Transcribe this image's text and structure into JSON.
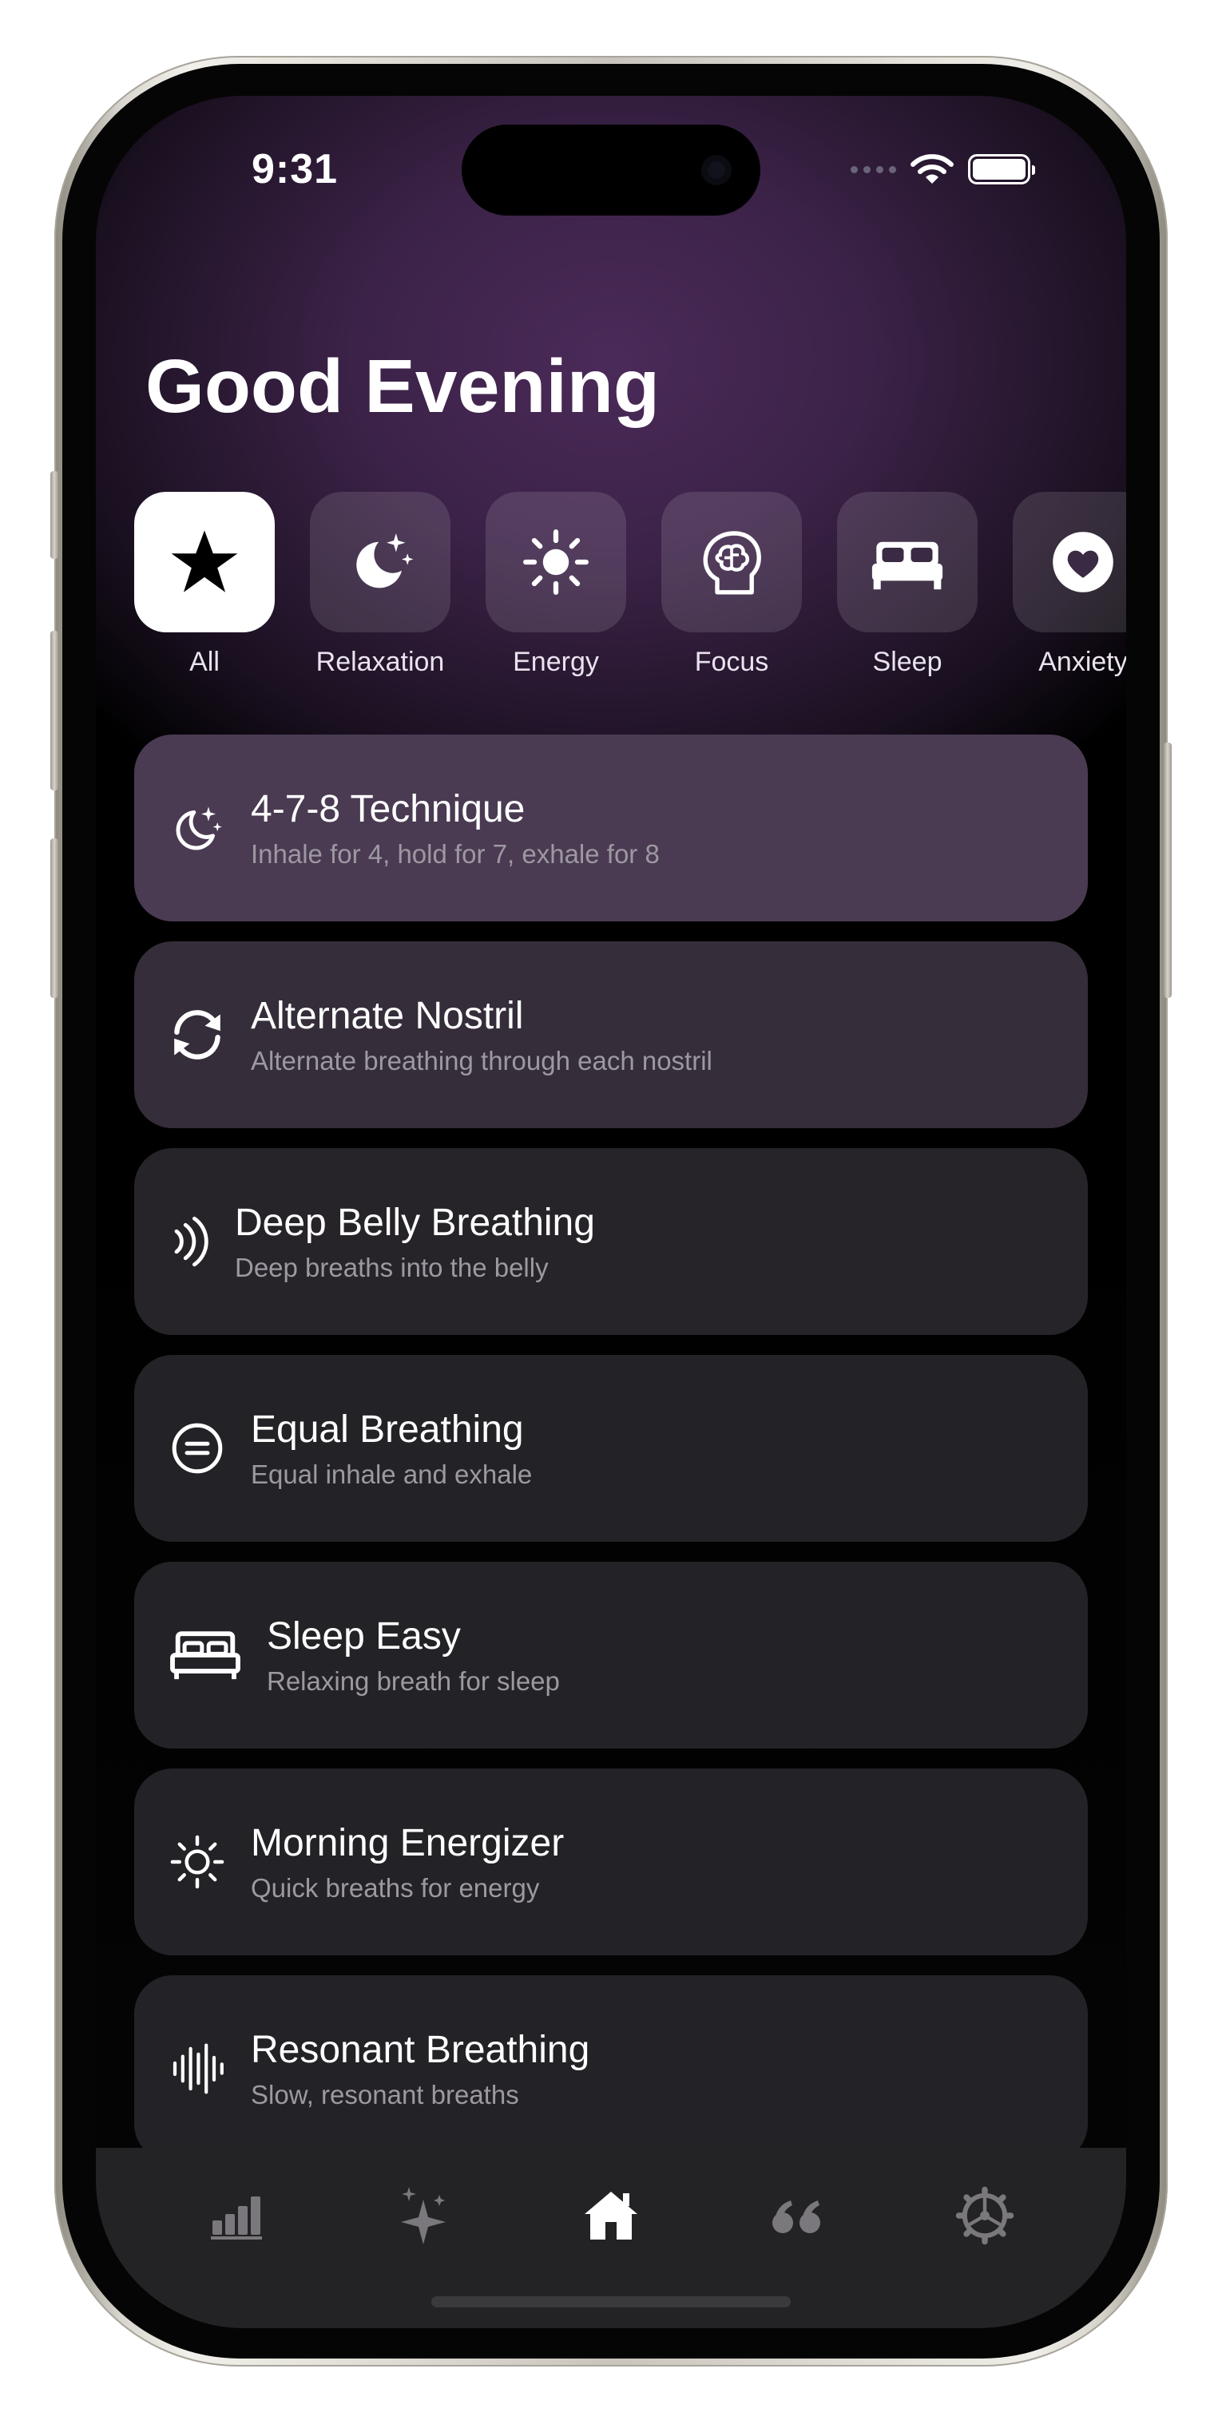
{
  "status_bar": {
    "time": "9:31"
  },
  "header": {
    "greeting": "Good Evening"
  },
  "categories": [
    {
      "label": "All",
      "icon": "star-icon",
      "active": true
    },
    {
      "label": "Relaxation",
      "icon": "moon-stars-icon",
      "active": false
    },
    {
      "label": "Energy",
      "icon": "sun-icon",
      "active": false
    },
    {
      "label": "Focus",
      "icon": "brain-icon",
      "active": false
    },
    {
      "label": "Sleep",
      "icon": "bed-icon",
      "active": false
    },
    {
      "label": "Anxiety",
      "icon": "heart-icon",
      "active": false
    }
  ],
  "exercises": [
    {
      "title": "4-7-8 Technique",
      "subtitle": "Inhale for 4, hold for 7, exhale for 8",
      "icon": "moon-stars-icon"
    },
    {
      "title": "Alternate Nostril",
      "subtitle": "Alternate breathing through each nostril",
      "icon": "cycle-arrows-icon"
    },
    {
      "title": "Deep Belly Breathing",
      "subtitle": "Deep breaths into the belly",
      "icon": "wave-icon"
    },
    {
      "title": "Equal Breathing",
      "subtitle": "Equal inhale and exhale",
      "icon": "equal-circle-icon"
    },
    {
      "title": "Sleep Easy",
      "subtitle": "Relaxing breath for sleep",
      "icon": "bed-icon"
    },
    {
      "title": "Morning Energizer",
      "subtitle": "Quick breaths for energy",
      "icon": "sun-icon"
    },
    {
      "title": "Resonant Breathing",
      "subtitle": "Slow, resonant breaths",
      "icon": "waveform-icon"
    }
  ],
  "tab_bar": [
    {
      "icon": "chart-bars-icon",
      "active": false
    },
    {
      "icon": "sparkles-icon",
      "active": false
    },
    {
      "icon": "home-icon",
      "active": true
    },
    {
      "icon": "quote-icon",
      "active": false
    },
    {
      "icon": "settings-gear-icon",
      "active": false
    }
  ],
  "colors": {
    "accent_purple": "#4b2a59",
    "card_bg": "#232226",
    "active_tile": "#ffffff"
  }
}
